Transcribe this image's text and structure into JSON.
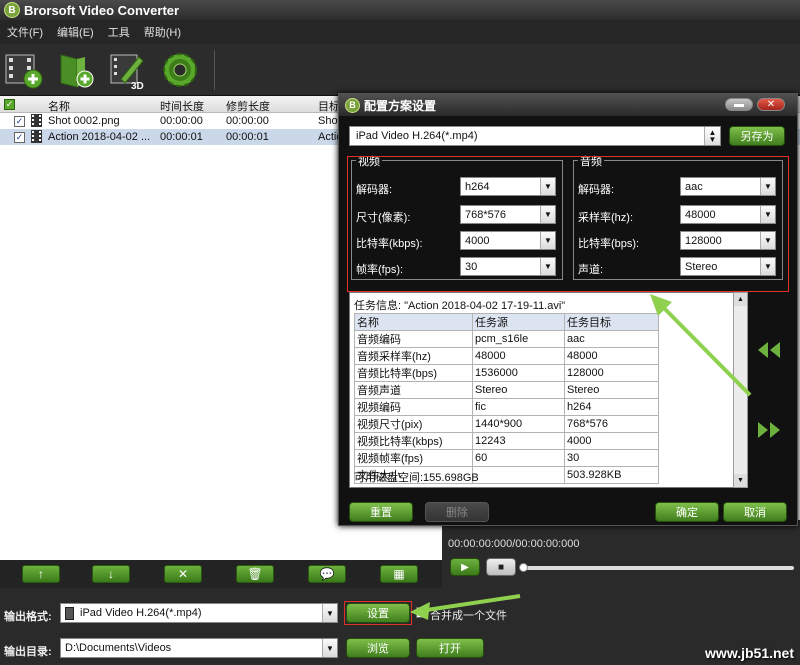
{
  "app": {
    "title": "Brorsoft Video Converter",
    "logo_text": "B"
  },
  "menu": [
    "文件(F)",
    "编辑(E)",
    "工具",
    "帮助(H)"
  ],
  "toolbar": {
    "buttons": [
      {
        "icon": "add-video-icon"
      },
      {
        "icon": "add-folder-icon"
      },
      {
        "icon": "edit-3d-icon"
      },
      {
        "icon": "settings-gear-icon"
      }
    ]
  },
  "file_list": {
    "headers": [
      "名称",
      "时间长度",
      "修剪长度",
      "目标"
    ],
    "rows": [
      {
        "name": "Shot 0002.png",
        "duration": "00:00:00",
        "trim": "00:00:00",
        "target": "Shot",
        "checked": true,
        "selected": false
      },
      {
        "name": "Action 2018-04-02 ...",
        "duration": "00:00:01",
        "trim": "00:00:01",
        "target": "Actio",
        "checked": true,
        "selected": true
      }
    ]
  },
  "bottom_tools": [
    "↑",
    "↓",
    "✕",
    "🗑",
    "💬",
    "▦"
  ],
  "output": {
    "format_label": "输出格式:",
    "format_value": "iPad Video H.264(*.mp4)",
    "settings_button": "设置",
    "merge_label": "合并成一个文件",
    "dir_label": "输出目录:",
    "dir_value": "D:\\Documents\\Videos",
    "browse_button": "浏览",
    "open_button": "打开"
  },
  "player": {
    "time": "00:00:00:000/00:00:00:000"
  },
  "dialog": {
    "title": "配置方案设置",
    "profile": "iPad Video H.264(*.mp4)",
    "save_as": "另存为",
    "video_group": {
      "title": "视频",
      "fields": [
        {
          "label": "解码器:",
          "value": "h264"
        },
        {
          "label": "尺寸(像素):",
          "value": "768*576"
        },
        {
          "label": "比特率(kbps):",
          "value": "4000"
        },
        {
          "label": "帧率(fps):",
          "value": "30"
        }
      ]
    },
    "audio_group": {
      "title": "音频",
      "fields": [
        {
          "label": "解码器:",
          "value": "aac"
        },
        {
          "label": "采样率(hz):",
          "value": "48000"
        },
        {
          "label": "比特率(bps):",
          "value": "128000"
        },
        {
          "label": "声道:",
          "value": "Stereo"
        }
      ]
    },
    "info": {
      "title": "任务信息: \"Action 2018-04-02 17-19-11.avi\"",
      "headers": [
        "名称",
        "任务源",
        "任务目标"
      ],
      "rows": [
        [
          "音频编码",
          "pcm_s16le",
          "aac"
        ],
        [
          "音频采样率(hz)",
          "48000",
          "48000"
        ],
        [
          "音频比特率(bps)",
          "1536000",
          "128000"
        ],
        [
          "音频声道",
          "Stereo",
          "Stereo"
        ],
        [
          "视频编码",
          "fic",
          "h264"
        ],
        [
          "视频尺寸(pix)",
          "1440*900",
          "768*576"
        ],
        [
          "视频比特率(kbps)",
          "12243",
          "4000"
        ],
        [
          "视频帧率(fps)",
          "60",
          "30"
        ],
        [
          "文件大小",
          "",
          "503.928KB"
        ]
      ],
      "disk_space": "可用磁盘空间:155.698GB"
    },
    "buttons": {
      "reset": "重置",
      "delete": "删除",
      "ok": "确定",
      "cancel": "取消"
    }
  },
  "watermark": "www.jb51.net",
  "colors": {
    "accent_green": "#4a8f25",
    "highlight_red": "#e0302b",
    "arrow_green": "#8fd14f"
  }
}
